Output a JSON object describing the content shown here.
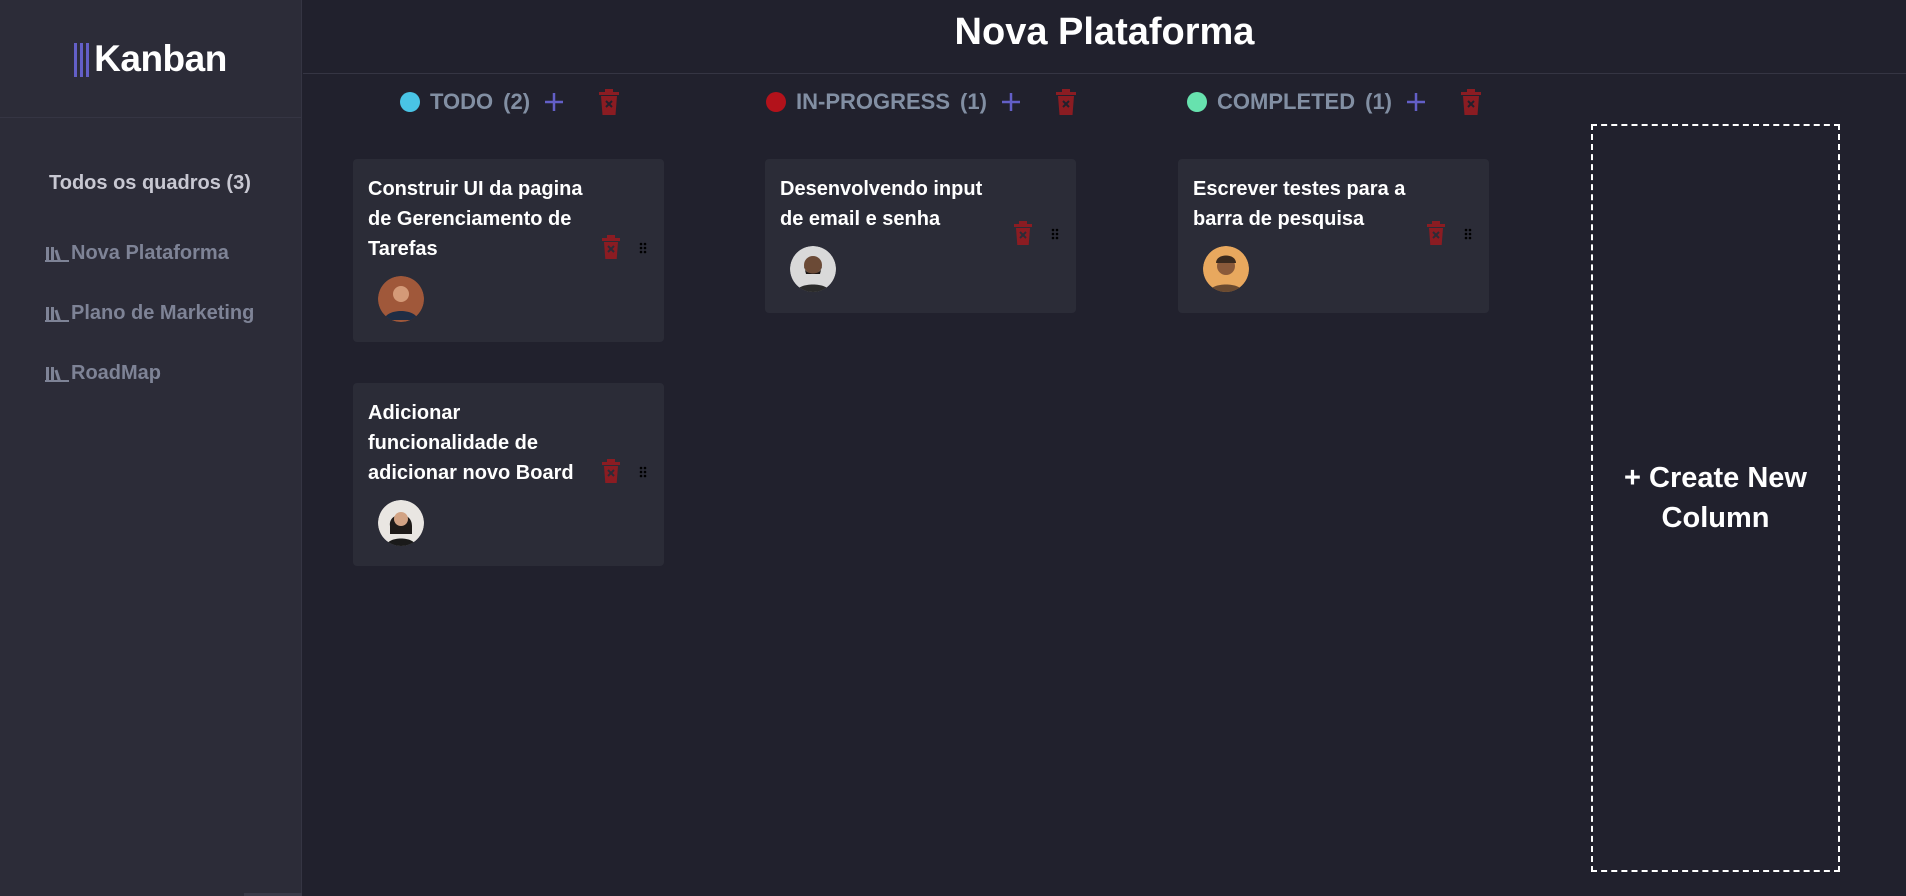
{
  "app": {
    "logo_text": "Kanban"
  },
  "sidebar": {
    "boards_count_label": "Todos os quadros (3)",
    "boards": [
      {
        "label": "Nova Plataforma"
      },
      {
        "label": "Plano de Marketing"
      },
      {
        "label": "RoadMap"
      }
    ]
  },
  "header": {
    "title": "Nova Plataforma"
  },
  "columns": [
    {
      "name": "TODO",
      "count": "(2)",
      "color": "#49c4e5",
      "cards": [
        {
          "title": "Construir UI da pagina de Gerenciamento de Tarefas",
          "avatar": "user-avatar"
        },
        {
          "title": "Adicionar funcionalidade de adicionar novo Board",
          "avatar": "user-avatar"
        }
      ]
    },
    {
      "name": "IN-PROGRESS",
      "count": "(1)",
      "color": "#b3121b",
      "cards": [
        {
          "title": "Desenvolvendo input de email e senha",
          "avatar": "user-avatar"
        }
      ]
    },
    {
      "name": "COMPLETED",
      "count": "(1)",
      "color": "#67e2ae",
      "cards": [
        {
          "title": "Escrever testes para a barra de pesquisa",
          "avatar": "user-avatar"
        }
      ]
    }
  ],
  "new_column": {
    "label": "+ Create New Column"
  },
  "colors": {
    "accent": "#635fc7",
    "danger": "#8b1c22",
    "background": "#21212d",
    "sidebar": "#2c2c38",
    "card": "#2b2c37"
  }
}
